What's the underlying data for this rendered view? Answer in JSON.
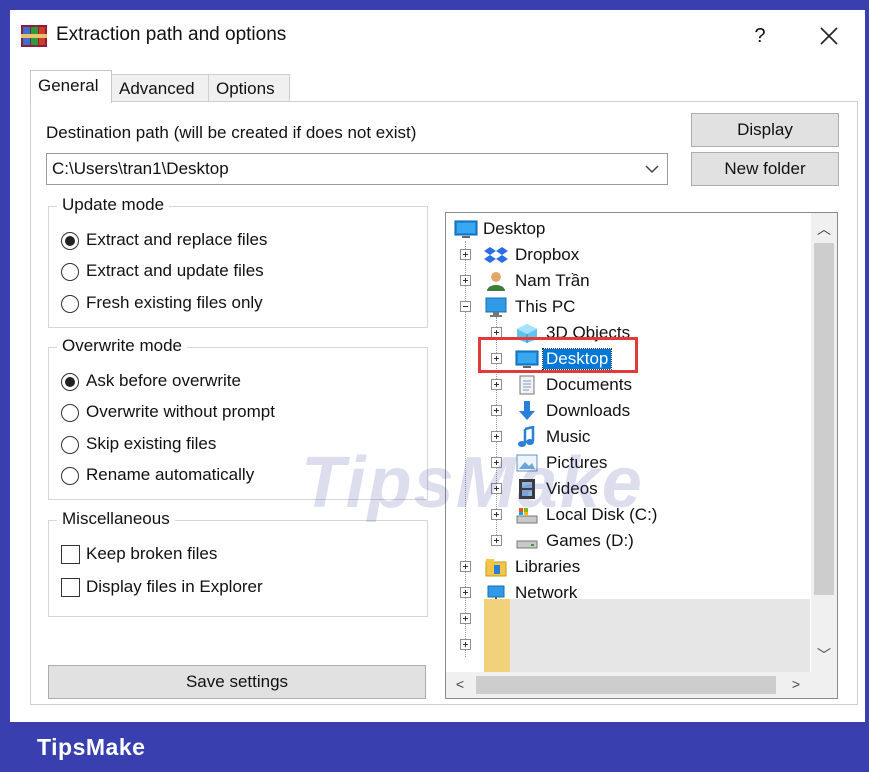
{
  "window": {
    "title": "Extraction path and options",
    "help_label": "?",
    "close_label": "✕"
  },
  "tabs": [
    {
      "label": "General",
      "active": true
    },
    {
      "label": "Advanced",
      "active": false
    },
    {
      "label": "Options",
      "active": false
    }
  ],
  "destination": {
    "label": "Destination path (will be created if does not exist)",
    "value": "C:\\Users\\tran1\\Desktop"
  },
  "buttons": {
    "display": "Display",
    "new_folder": "New folder",
    "save_settings": "Save settings"
  },
  "update_mode": {
    "title": "Update mode",
    "options": [
      {
        "label": "Extract and replace files",
        "checked": true
      },
      {
        "label": "Extract and update files",
        "checked": false
      },
      {
        "label": "Fresh existing files only",
        "checked": false
      }
    ]
  },
  "overwrite_mode": {
    "title": "Overwrite mode",
    "options": [
      {
        "label": "Ask before overwrite",
        "checked": true
      },
      {
        "label": "Overwrite without prompt",
        "checked": false
      },
      {
        "label": "Skip existing files",
        "checked": false
      },
      {
        "label": "Rename automatically",
        "checked": false
      }
    ]
  },
  "miscellaneous": {
    "title": "Miscellaneous",
    "options": [
      {
        "label": "Keep broken files",
        "checked": false
      },
      {
        "label": "Display files in Explorer",
        "checked": false
      }
    ]
  },
  "tree": {
    "root": "Desktop",
    "items": [
      {
        "label": "Dropbox",
        "icon": "dropbox-icon"
      },
      {
        "label": "Nam Trần",
        "icon": "user-icon"
      },
      {
        "label": "This PC",
        "icon": "computer-icon"
      },
      {
        "label": "3D Objects",
        "icon": "3d-objects-icon"
      },
      {
        "label": "Desktop",
        "icon": "desktop-icon",
        "selected": true
      },
      {
        "label": "Documents",
        "icon": "documents-icon"
      },
      {
        "label": "Downloads",
        "icon": "downloads-icon"
      },
      {
        "label": "Music",
        "icon": "music-icon"
      },
      {
        "label": "Pictures",
        "icon": "pictures-icon"
      },
      {
        "label": "Videos",
        "icon": "videos-icon"
      },
      {
        "label": "Local Disk (C:)",
        "icon": "local-disk-icon"
      },
      {
        "label": "Games (D:)",
        "icon": "drive-icon"
      },
      {
        "label": "Libraries",
        "icon": "libraries-icon"
      },
      {
        "label": "Network",
        "icon": "network-icon"
      }
    ]
  },
  "footer": {
    "brand": "TipsMake"
  },
  "watermark": "TipsMake",
  "colors": {
    "frame": "#3a3fb0",
    "selection": "#0078d7",
    "highlight": "#e03a3a"
  }
}
